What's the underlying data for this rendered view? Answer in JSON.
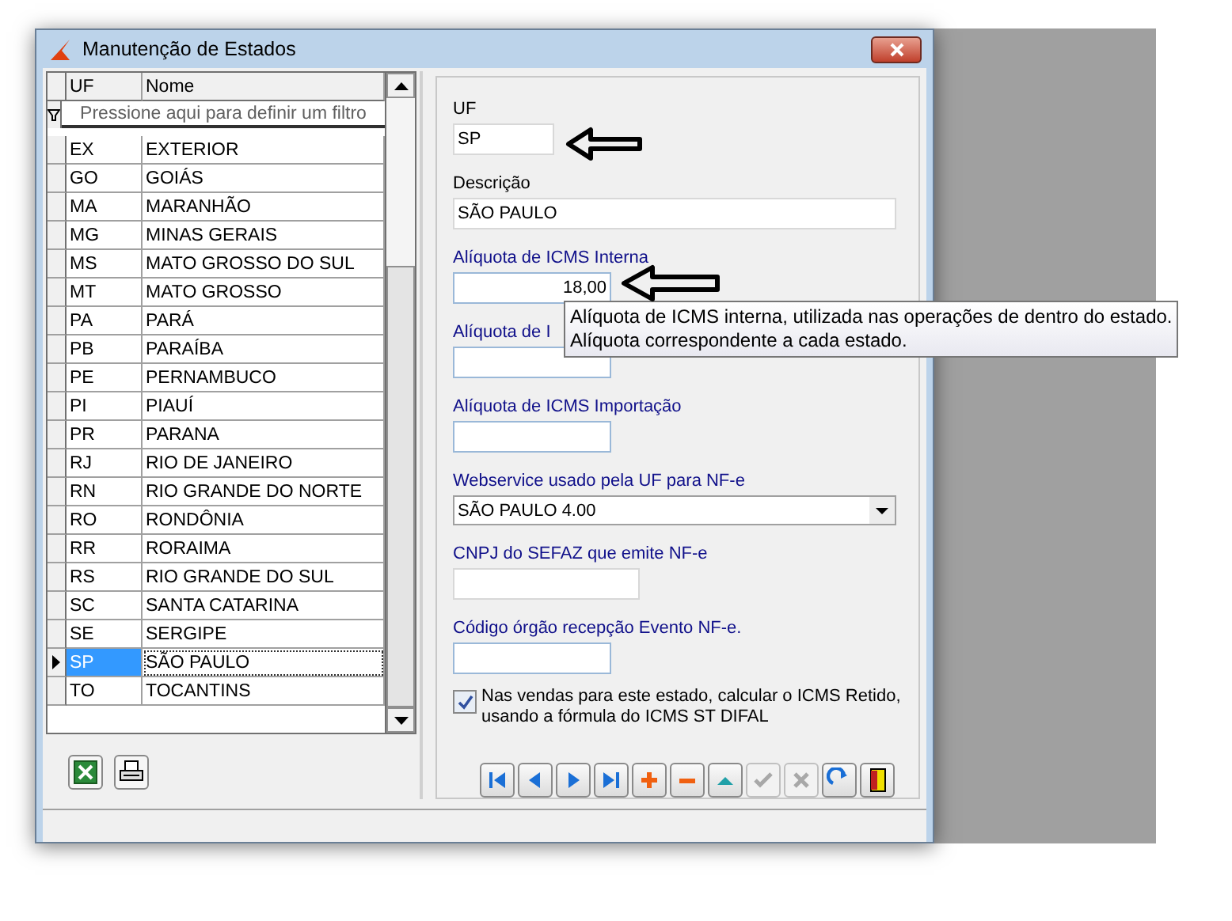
{
  "window": {
    "title": "Manutenção de Estados"
  },
  "grid": {
    "columns": [
      "UF",
      "Nome"
    ],
    "filter_hint": "Pressione aqui para definir um filtro",
    "rows": [
      {
        "uf": "EX",
        "nome": "EXTERIOR",
        "selected": false
      },
      {
        "uf": "GO",
        "nome": "GOIÁS",
        "selected": false
      },
      {
        "uf": "MA",
        "nome": "MARANHÃO",
        "selected": false
      },
      {
        "uf": "MG",
        "nome": "MINAS GERAIS",
        "selected": false
      },
      {
        "uf": "MS",
        "nome": "MATO GROSSO DO SUL",
        "selected": false
      },
      {
        "uf": "MT",
        "nome": "MATO GROSSO",
        "selected": false
      },
      {
        "uf": "PA",
        "nome": "PARÁ",
        "selected": false
      },
      {
        "uf": "PB",
        "nome": "PARAÍBA",
        "selected": false
      },
      {
        "uf": "PE",
        "nome": "PERNAMBUCO",
        "selected": false
      },
      {
        "uf": "PI",
        "nome": "PIAUÍ",
        "selected": false
      },
      {
        "uf": "PR",
        "nome": "PARANA",
        "selected": false
      },
      {
        "uf": "RJ",
        "nome": "RIO DE JANEIRO",
        "selected": false
      },
      {
        "uf": "RN",
        "nome": "RIO GRANDE DO NORTE",
        "selected": false
      },
      {
        "uf": "RO",
        "nome": "RONDÔNIA",
        "selected": false
      },
      {
        "uf": "RR",
        "nome": "RORAIMA",
        "selected": false
      },
      {
        "uf": "RS",
        "nome": "RIO GRANDE DO SUL",
        "selected": false
      },
      {
        "uf": "SC",
        "nome": "SANTA CATARINA",
        "selected": false
      },
      {
        "uf": "SE",
        "nome": "SERGIPE",
        "selected": false
      },
      {
        "uf": "SP",
        "nome": "SÃO PAULO",
        "selected": true
      },
      {
        "uf": "TO",
        "nome": "TOCANTINS",
        "selected": false
      }
    ]
  },
  "grid_buttons": [
    {
      "kind": "excel"
    },
    {
      "kind": "print"
    }
  ],
  "form": {
    "fields": [
      {
        "kind": "short",
        "label": "UF",
        "accent": false,
        "value": "SP"
      },
      {
        "kind": "wide",
        "label": "Descrição",
        "accent": false,
        "value": "SÃO PAULO"
      },
      {
        "kind": "number",
        "label": "Alíquota de ICMS Interna",
        "accent": true,
        "value": "18,00"
      },
      {
        "kind": "number",
        "label": "Alíquota de I",
        "accent": true
      },
      {
        "kind": "number",
        "label": "Alíquota de ICMS Importação",
        "accent": true
      },
      {
        "kind": "select",
        "label": "Webservice usado pela UF para NF-e",
        "accent": true,
        "value": "SÃO PAULO 4.00"
      },
      {
        "kind": "medium",
        "label": "CNPJ do SEFAZ que emite NF-e",
        "accent": true
      },
      {
        "kind": "number",
        "label": "Código órgão recepção Evento NF-e.",
        "accent": true
      }
    ],
    "checkbox": {
      "label": "Nas vendas para este estado, calcular o ICMS Retido, usando a fórmula do ICMS ST DIFAL",
      "checked": true
    }
  },
  "toolbar": [
    {
      "kind": "first",
      "disabled": false
    },
    {
      "kind": "prev",
      "disabled": false
    },
    {
      "kind": "next",
      "disabled": false
    },
    {
      "kind": "last",
      "disabled": false
    },
    {
      "kind": "add",
      "disabled": false
    },
    {
      "kind": "remove",
      "disabled": false
    },
    {
      "kind": "edit",
      "disabled": false
    },
    {
      "kind": "confirm",
      "disabled": true
    },
    {
      "kind": "cancel",
      "disabled": true
    },
    {
      "kind": "refresh",
      "disabled": false
    },
    {
      "kind": "exit",
      "disabled": false
    }
  ],
  "tooltip": {
    "lines": [
      "Alíquota de ICMS interna, utilizada nas operações de dentro do estado.",
      "Alíquota correspondente a cada estado."
    ]
  }
}
